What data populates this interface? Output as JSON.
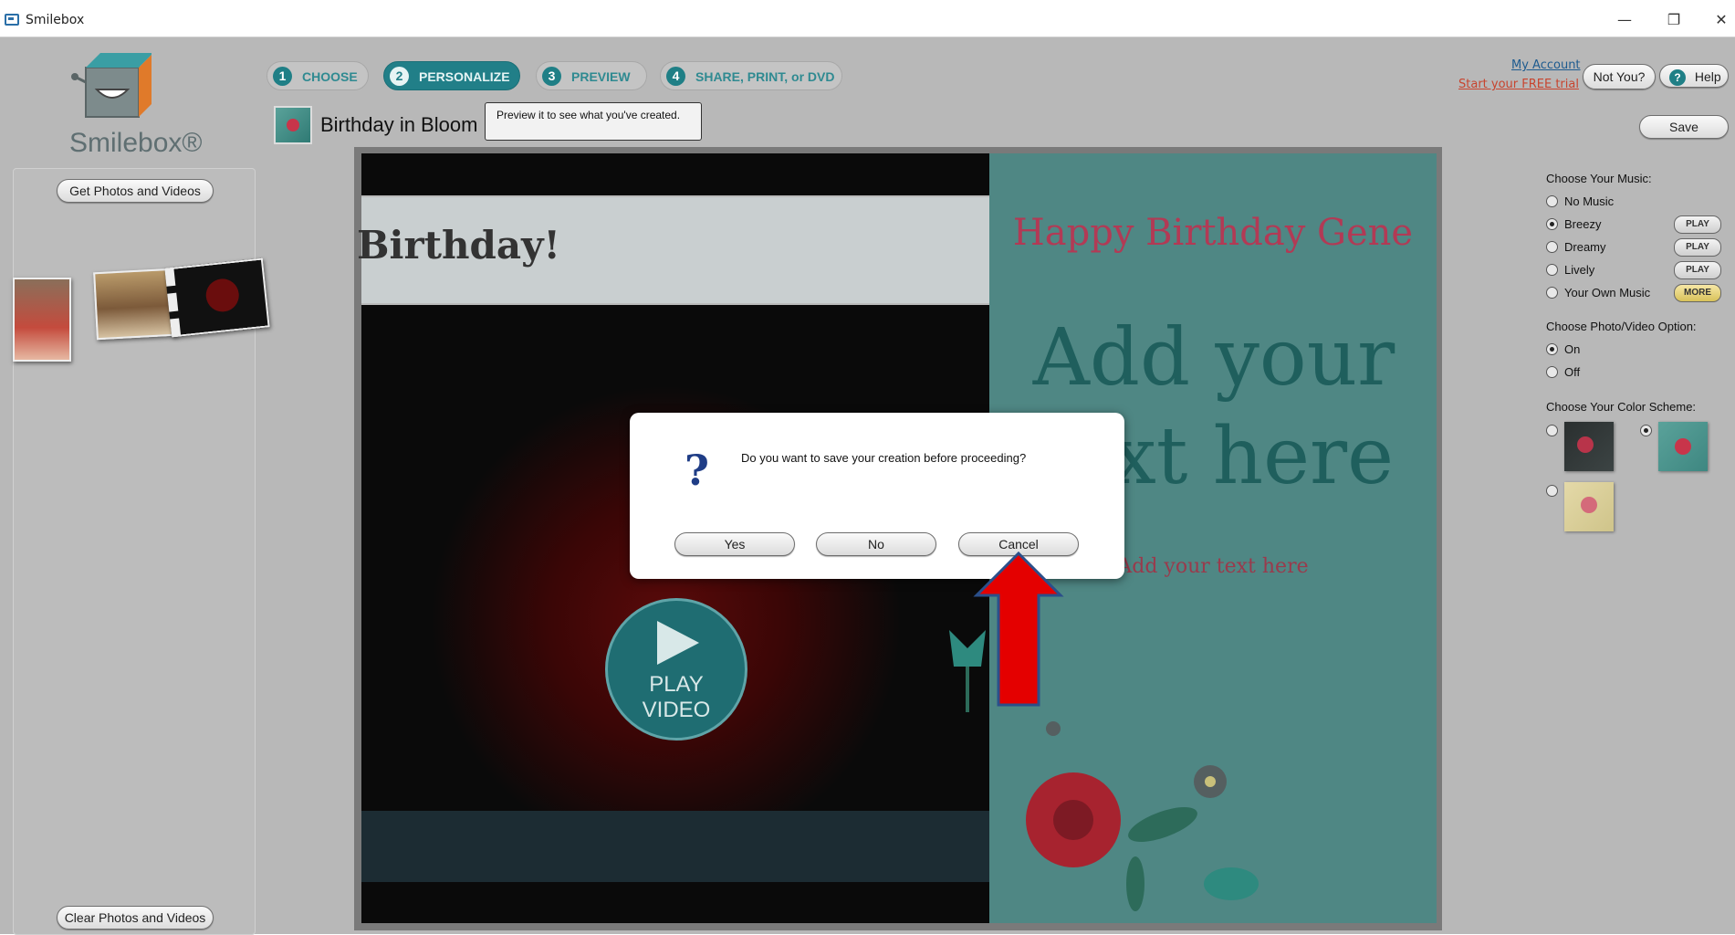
{
  "window": {
    "title": "Smilebox",
    "minimize": "—",
    "restore": "❐",
    "close": "✕"
  },
  "logo": {
    "text": "Smilebox®"
  },
  "left": {
    "get_button": "Get Photos and Videos",
    "clear_button": "Clear Photos and Videos"
  },
  "steps": [
    {
      "num": "1",
      "label": "CHOOSE"
    },
    {
      "num": "2",
      "label": "PERSONALIZE"
    },
    {
      "num": "3",
      "label": "PREVIEW"
    },
    {
      "num": "4",
      "label": "SHARE, PRINT, or DVD"
    }
  ],
  "header": {
    "my_account": "My Account",
    "free_trial": "Start your FREE trial",
    "not_you": "Not You?",
    "help": "Help",
    "project_title": "Birthday in Bloom",
    "save": "Save"
  },
  "tooltip": {
    "text": "Preview it to see what you've created."
  },
  "canvas": {
    "banner_text": "Birthday!",
    "play_label_1": "PLAY",
    "play_label_2": "VIDEO",
    "card_title": "Happy Birthday Gene",
    "card_big": "Add your text here",
    "card_small": "Add your text here"
  },
  "right": {
    "music_heading": "Choose Your Music:",
    "music_options": [
      {
        "label": "No Music",
        "button": ""
      },
      {
        "label": "Breezy",
        "button": "PLAY"
      },
      {
        "label": "Dreamy",
        "button": "PLAY"
      },
      {
        "label": "Lively",
        "button": "PLAY"
      },
      {
        "label": "Your Own Music",
        "button": "MORE"
      }
    ],
    "music_selected": "Breezy",
    "photo_heading": "Choose Photo/Video Option:",
    "photo_options": [
      "On",
      "Off"
    ],
    "photo_selected": "On",
    "color_heading": "Choose Your Color Scheme:"
  },
  "dialog": {
    "message": "Do you want to save your creation before proceeding?",
    "yes": "Yes",
    "no": "No",
    "cancel": "Cancel"
  },
  "colors": {
    "accent": "#217f88",
    "card": "#4f8784",
    "arrow": "#e40000"
  }
}
